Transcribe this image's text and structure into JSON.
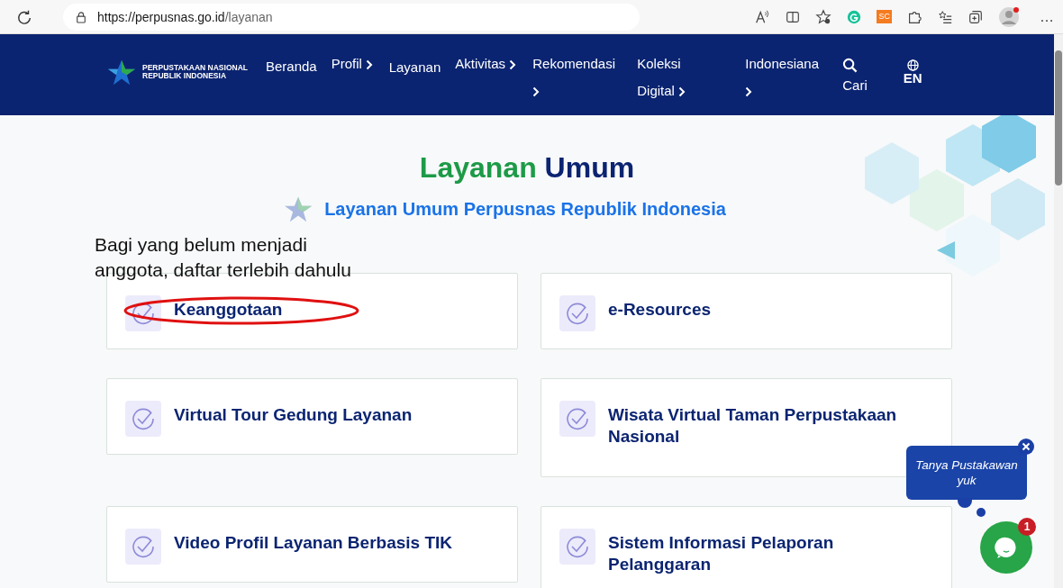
{
  "browser": {
    "url_host": "https://perpusnas.go.id",
    "url_path": "/layanan",
    "extension_badge": "SC",
    "more": "…"
  },
  "nav": {
    "logo_line_1": "PERPUSTAKAAN NASIONAL",
    "logo_line_2": "REPUBLIK INDONESIA",
    "items": [
      {
        "label": "Beranda",
        "dropdown": false
      },
      {
        "label": "Profil",
        "dropdown": true
      },
      {
        "label": "Layanan",
        "dropdown": false
      },
      {
        "label": "Aktivitas",
        "dropdown": true
      },
      {
        "label": "Rekomendasi",
        "dropdown": true
      },
      {
        "label": "Koleksi Digital",
        "dropdown": true
      },
      {
        "label": "Indonesiana",
        "dropdown": true
      }
    ],
    "search_label": "Cari",
    "language": "EN"
  },
  "heading": {
    "accent": "Layanan",
    "rest": "Umum",
    "subtitle": "Layanan Umum Perpusnas Republik Indonesia"
  },
  "services": [
    {
      "title": "Keanggotaan",
      "circled": true
    },
    {
      "title": "e-Resources",
      "circled": false
    },
    {
      "title": "Virtual Tour Gedung Layanan",
      "circled": false
    },
    {
      "title": "Wisata Virtual Taman Perpustakaan Nasional",
      "circled": false
    },
    {
      "title": "Video Profil Layanan Berbasis TIK",
      "circled": false
    },
    {
      "title": "Sistem Informasi Pelaporan Pelanggaran",
      "circled": false
    }
  ],
  "annotation": "Bagi yang belum menjadi anggota, daftar terlebih dahulu",
  "chat": {
    "prompt": "Tanya Pustakawan yuk",
    "unread": "1"
  }
}
